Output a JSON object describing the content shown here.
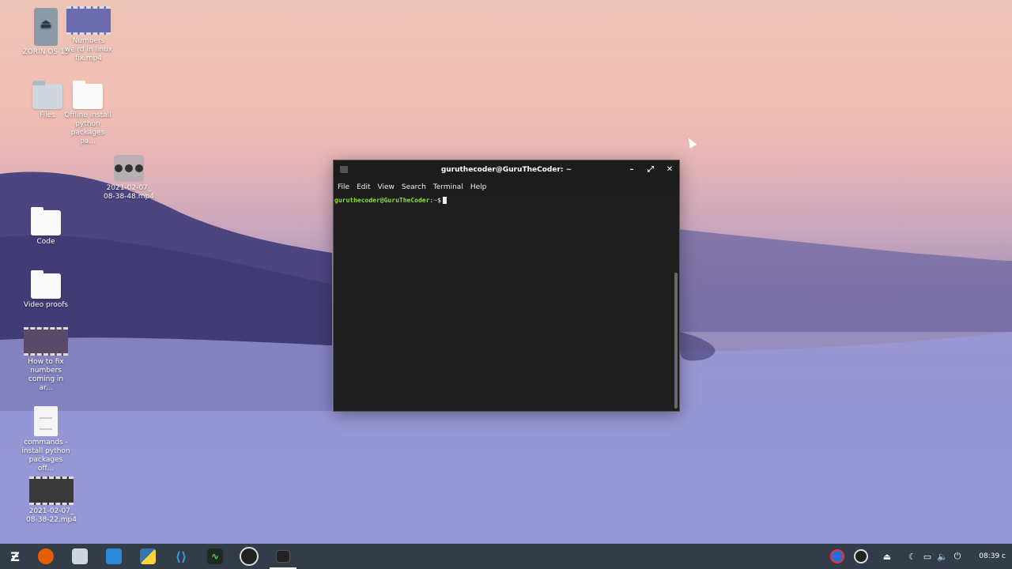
{
  "desktop": {
    "icons": [
      {
        "label": "ZORIN OS 15",
        "kind": "drive"
      },
      {
        "label": "Numbers weird in linux fix.mp4",
        "kind": "video"
      },
      {
        "label": "Files",
        "kind": "folder-grey"
      },
      {
        "label": "Offline install python packages pa...",
        "kind": "folder"
      },
      {
        "label": "2021-02-07_ 08-38-48.mp4",
        "kind": "dots"
      },
      {
        "label": "Code",
        "kind": "folder"
      },
      {
        "label": "Video proofs",
        "kind": "folder"
      },
      {
        "label": "How to fix numbers coming in ar...",
        "kind": "video"
      },
      {
        "label": "commands - install python packages off...",
        "kind": "document"
      },
      {
        "label": "2021-02-07_ 08-38-22.mp4",
        "kind": "video"
      }
    ]
  },
  "terminal": {
    "title": "guruthecoder@GuruTheCoder: ~",
    "menu": [
      "File",
      "Edit",
      "View",
      "Search",
      "Terminal",
      "Help"
    ],
    "prompt_user": "guruthecoder@GuruTheCoder",
    "prompt_sep": ":",
    "prompt_path": "~",
    "prompt_symbol": "$",
    "minimize_icon": "minimize-icon",
    "maximize_icon": "maximize-icon",
    "close_icon": "close-icon"
  },
  "taskbar": {
    "apps": [
      "zorin-menu-icon",
      "firefox-icon",
      "files-icon",
      "software-store-icon",
      "python-icon",
      "vscode-icon",
      "system-monitor-icon",
      "obs-icon",
      "terminal-icon"
    ],
    "tray": [
      "update-notifier-icon",
      "obs-tray-icon",
      "eject-icon",
      "night-light-icon",
      "display-icon",
      "volume-icon",
      "power-icon"
    ],
    "clock": "08:39 ϲ"
  }
}
